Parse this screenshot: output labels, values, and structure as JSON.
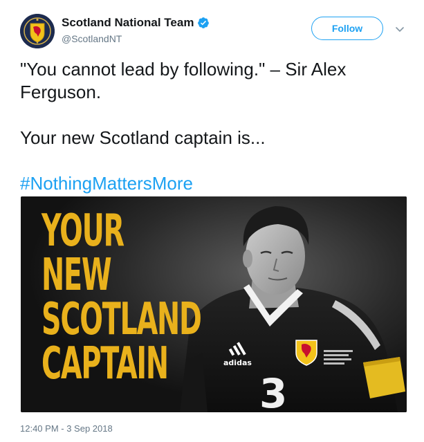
{
  "account": {
    "display_name": "Scotland National Team",
    "handle": "@ScotlandNT",
    "verified": true,
    "avatar_icon": "scotland-crest-icon"
  },
  "actions": {
    "follow_label": "Follow",
    "more_icon": "chevron-down-icon"
  },
  "tweet": {
    "paragraph_1": "\"You cannot lead by following.\" – Sir Alex Ferguson.",
    "paragraph_2": "Your new Scotland captain is...",
    "hashtag": "#NothingMattersMore"
  },
  "media": {
    "headline_lines": [
      "YOUR",
      "NEW",
      "SCOTLAND",
      "CAPTAIN"
    ],
    "shirt_brand": "adidas",
    "shirt_number": "3"
  },
  "timestamp": "12:40 PM - 3 Sep 2018",
  "colors": {
    "link": "#1da1f2",
    "headline_yellow": "#e9b11c",
    "secondary_text": "#657786"
  }
}
